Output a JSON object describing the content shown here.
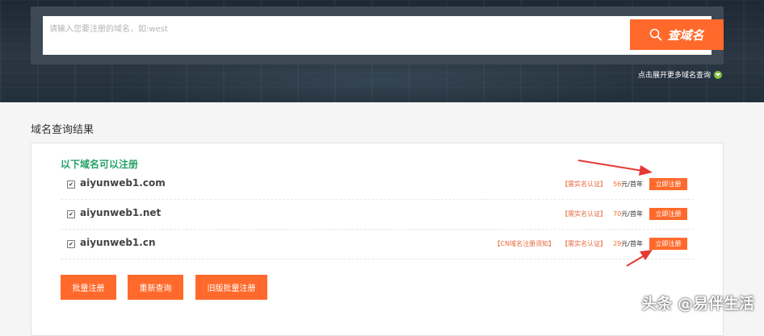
{
  "search": {
    "placeholder": "请输入您要注册的域名，如:west",
    "button_label": "查域名",
    "expand_link": "点击展开更多域名查询"
  },
  "results": {
    "section_title": "域名查询结果",
    "available_title": "以下域名可以注册",
    "rows": [
      {
        "domain": "aiyunweb1.com",
        "cn_note": "",
        "realname_note": "【需实名认证】",
        "price_value": "56",
        "price_unit": "元/首年",
        "register_label": "立即注册"
      },
      {
        "domain": "aiyunweb1.net",
        "cn_note": "",
        "realname_note": "【需实名认证】",
        "price_value": "70",
        "price_unit": "元/首年",
        "register_label": "立即注册"
      },
      {
        "domain": "aiyunweb1.cn",
        "cn_note": "【CN域名注册须知】",
        "realname_note": "【需实名认证】",
        "price_value": "29",
        "price_unit": "元/首年",
        "register_label": "立即注册"
      }
    ],
    "actions": {
      "bulk_register": "批量注册",
      "requery": "重新查询",
      "old_bulk_register": "旧版批量注册"
    }
  },
  "watermark": "头条 @易伴生活",
  "colors": {
    "accent": "#ff6a2c",
    "available_green": "#26a269",
    "hero_bg": "#1c2833",
    "arrow_red": "#e53935"
  },
  "icons": {
    "search_button": "search-icon",
    "expand": "chevron-down-icon"
  }
}
